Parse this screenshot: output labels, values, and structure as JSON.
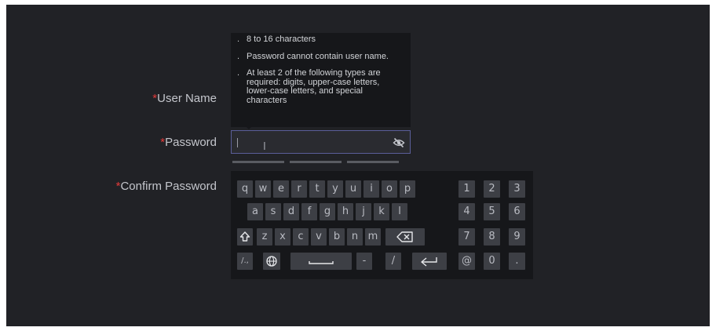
{
  "form": {
    "user_name_label": "User Name",
    "password_label": "Password",
    "confirm_password_label": "Confirm Password",
    "required_mark": "*",
    "password_value": ""
  },
  "tooltip": {
    "bullet": ".",
    "rules": [
      "8 to 16 characters",
      "Password cannot contain user name.",
      "At least 2 of the following types are required: digits, upper-case letters, lower-case letters, and special characters"
    ]
  },
  "password_strength_segments": 3,
  "keyboard": {
    "row1": [
      "q",
      "w",
      "e",
      "r",
      "t",
      "y",
      "u",
      "i",
      "o",
      "p"
    ],
    "row2": [
      "a",
      "s",
      "d",
      "f",
      "g",
      "h",
      "j",
      "k",
      "l"
    ],
    "row3": [
      "z",
      "x",
      "c",
      "v",
      "b",
      "n",
      "m"
    ],
    "row4": {
      "symbols": "/.,",
      "dash": "-",
      "slash": "/"
    },
    "numpad": [
      [
        "1",
        "2",
        "3"
      ],
      [
        "4",
        "5",
        "6"
      ],
      [
        "7",
        "8",
        "9"
      ],
      [
        "@",
        "0",
        "."
      ]
    ]
  },
  "colors": {
    "background": "#212226",
    "panel": "#16171a",
    "key": "#3d3f45",
    "label": "#c4c6cc",
    "required": "#e23a3a",
    "focus_border": "#5b5f9a"
  },
  "icons": {
    "password_visibility": "eye-off-icon",
    "shift": "shift-icon",
    "backspace": "backspace-icon",
    "language": "globe-icon",
    "space": "space-icon",
    "enter": "enter-icon"
  }
}
